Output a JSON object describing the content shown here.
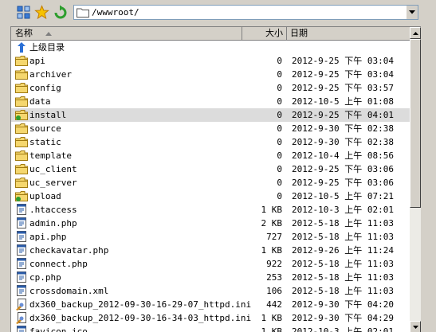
{
  "toolbar": {
    "address": "/wwwroot/",
    "connect_icon": "connect-icon",
    "favorite_icon": "star-icon",
    "refresh_icon": "refresh-icon"
  },
  "columns": {
    "name": "名称",
    "size": "大小",
    "date": "日期"
  },
  "parent_item": {
    "name": "上级目录",
    "icon": "up-arrow-icon"
  },
  "files": [
    {
      "name": "api",
      "size": "0",
      "date": "2012-9-25 下午 03:04",
      "type": "folder"
    },
    {
      "name": "archiver",
      "size": "0",
      "date": "2012-9-25 下午 03:04",
      "type": "folder"
    },
    {
      "name": "config",
      "size": "0",
      "date": "2012-9-25 下午 03:57",
      "type": "folder"
    },
    {
      "name": "data",
      "size": "0",
      "date": "2012-10-5 上午 01:08",
      "type": "folder"
    },
    {
      "name": "install",
      "size": "0",
      "date": "2012-9-25 下午 04:01",
      "type": "folder-green",
      "selected": true
    },
    {
      "name": "source",
      "size": "0",
      "date": "2012-9-30 下午 02:38",
      "type": "folder"
    },
    {
      "name": "static",
      "size": "0",
      "date": "2012-9-30 下午 02:38",
      "type": "folder"
    },
    {
      "name": "template",
      "size": "0",
      "date": "2012-10-4 上午 08:56",
      "type": "folder"
    },
    {
      "name": "uc_client",
      "size": "0",
      "date": "2012-9-25 下午 03:06",
      "type": "folder"
    },
    {
      "name": "uc_server",
      "size": "0",
      "date": "2012-9-25 下午 03:06",
      "type": "folder"
    },
    {
      "name": "upload",
      "size": "0",
      "date": "2012-10-5 上午 07:21",
      "type": "folder-green"
    },
    {
      "name": ".htaccess",
      "size": "1 KB",
      "date": "2012-10-3 上午 02:01",
      "type": "file"
    },
    {
      "name": "admin.php",
      "size": "2 KB",
      "date": "2012-5-18 上午 11:03",
      "type": "file"
    },
    {
      "name": "api.php",
      "size": "727",
      "date": "2012-5-18 上午 11:03",
      "type": "file"
    },
    {
      "name": "checkavatar.php",
      "size": "1 KB",
      "date": "2012-9-26 上午 11:24",
      "type": "file"
    },
    {
      "name": "connect.php",
      "size": "922",
      "date": "2012-5-18 上午 11:03",
      "type": "file"
    },
    {
      "name": "cp.php",
      "size": "253",
      "date": "2012-5-18 上午 11:03",
      "type": "file"
    },
    {
      "name": "crossdomain.xml",
      "size": "106",
      "date": "2012-5-18 上午 11:03",
      "type": "file"
    },
    {
      "name": "dx360_backup_2012-09-30-16-29-07_httpd.ini",
      "size": "442",
      "date": "2012-9-30 下午 04:20",
      "type": "ini"
    },
    {
      "name": "dx360_backup_2012-09-30-16-34-03_httpd.ini",
      "size": "1 KB",
      "date": "2012-9-30 下午 04:29",
      "type": "ini"
    },
    {
      "name": "favicon.ico",
      "size": "1 KB",
      "date": "2012-10-3 上午 02:01",
      "type": "file"
    }
  ],
  "colors": {
    "selected_row": "#dcdcdc",
    "folder": "#f5d76e",
    "folder_green_mark": "#2e9e2e"
  }
}
